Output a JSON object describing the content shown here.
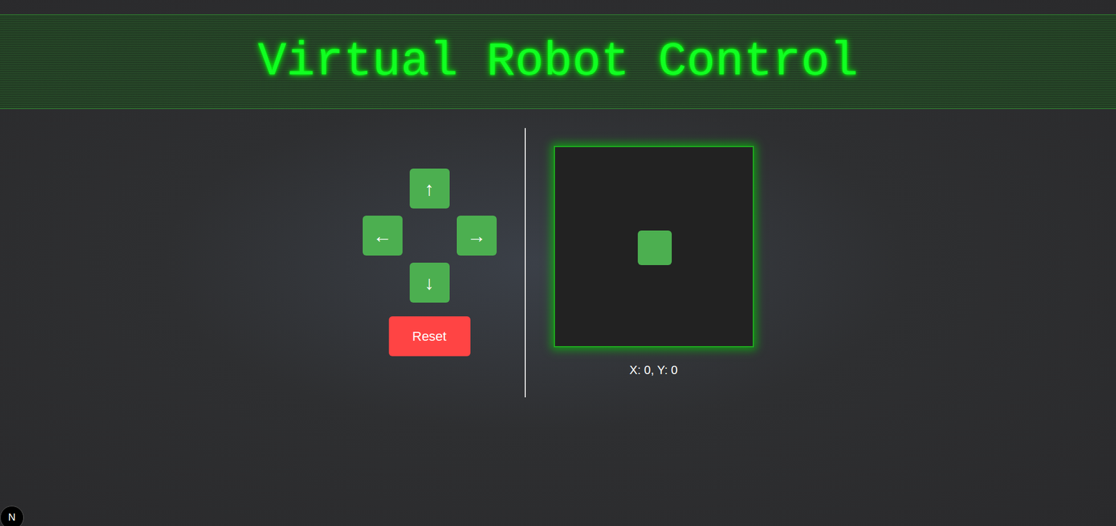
{
  "header": {
    "title": "Virtual Robot Control"
  },
  "controls": {
    "up": "↑",
    "left": "←",
    "right": "→",
    "down": "↓",
    "reset": "Reset"
  },
  "arena": {
    "coordinates": "X: 0, Y: 0"
  },
  "badge": {
    "label": "N"
  }
}
